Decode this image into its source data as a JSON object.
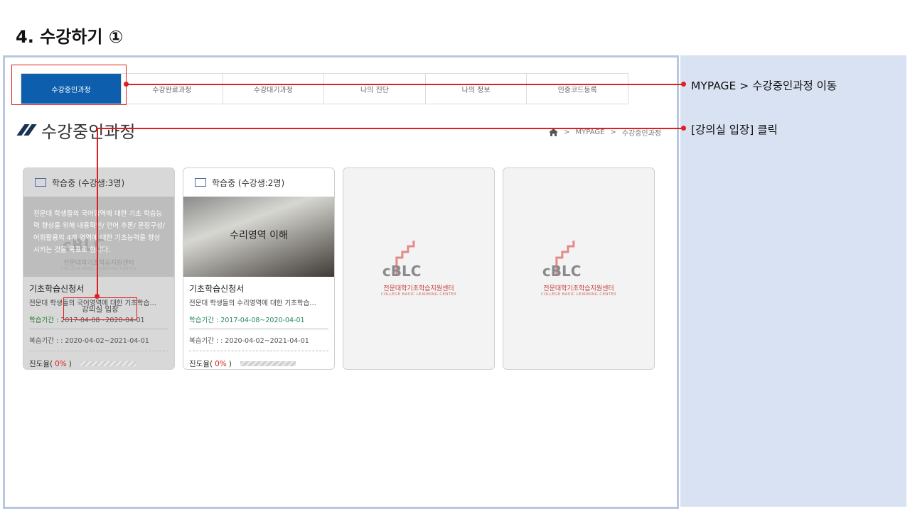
{
  "slide_title": "4. 수강하기 ①",
  "nav": {
    "tabs": [
      "수강중인과정",
      "수강완료과정",
      "수강대기과정",
      "나의 진단",
      "나의 정보",
      "인증코드등록"
    ],
    "active_index": 0
  },
  "page": {
    "title": "수강중인과정",
    "breadcrumb": [
      "MYPAGE",
      "수강중인과정"
    ]
  },
  "cards": [
    {
      "status": "학습중 (수강생:3명)",
      "description": "전문대 학생들의 국어영역에 대한 기초 학습능력 향상을 위해 내용확인/ 언어 추론/ 문장구성/ 어휘활용의 4개 영역에 대한 기초능력을 향상시키는 것을 목표로 합니다.",
      "title": "기초학습신청서",
      "subtitle": "전문대 학생들의 국어영역에 대한 기초학습…",
      "study_label": "학습기간",
      "study_period": " : 2017-04-08~2020-04-01",
      "review_period": "복습기간 : : 2020-04-02~2021-04-01",
      "progress_label": "진도율(",
      "progress_pct": "0%",
      "progress_close": ")",
      "progress_value": 0,
      "enter_button": "강의실 입장"
    },
    {
      "status": "학습중 (수강생:2명)",
      "image_title": "수리영역 이해",
      "title": "기초학습신청서",
      "subtitle": "전문대 학생들의 수리영역에 대한 기초학습…",
      "study_period": "학습기간 : 2017-04-08~2020-04-01",
      "review_period": "복습기간 : : 2020-04-02~2021-04-01",
      "progress_label": "진도율(",
      "progress_pct": "0%",
      "progress_close": ")",
      "progress_value": 0
    }
  ],
  "logo": {
    "wordmark": "cBLC",
    "line1": "전문대학기초학습지원센터",
    "line2": "COLLEGE BASIC LEARNING CENTER"
  },
  "annotations": {
    "nav_step": "MYPAGE > 수강중인과정 이동",
    "enter_step": "[강의실 입장] 클릭"
  },
  "colors": {
    "active_tab": "#0d5fad",
    "highlight": "#e02020",
    "side_panel": "#d9e2f2",
    "frame_border": "#b7c8e0"
  }
}
